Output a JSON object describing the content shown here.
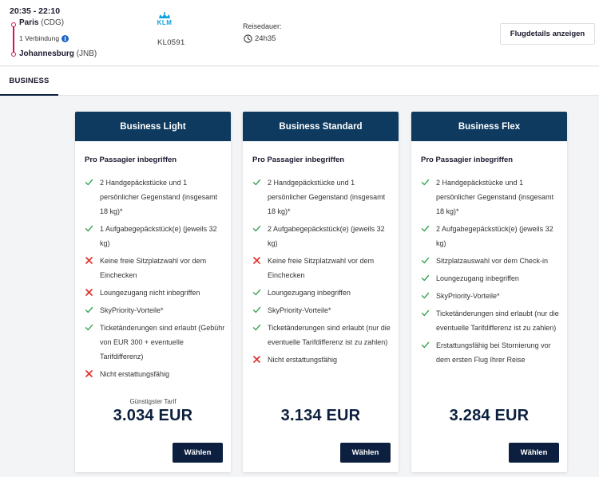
{
  "flight": {
    "times": "20:35 - 22:10",
    "origin_city": "Paris",
    "origin_code": "(CDG)",
    "connections": "1 Verbindung",
    "destination_city": "Johannesburg",
    "destination_code": "(JNB)",
    "airline": "KLM",
    "flight_number": "KL0591",
    "duration_label": "Reisedauer:",
    "duration_value": "24h35",
    "details_button": "Flugdetails anzeigen",
    "route_color": "#d2145a"
  },
  "cabin_tabs": [
    {
      "label": "BUSINESS",
      "active": true
    }
  ],
  "colors": {
    "header_bg": "#0e3a5f",
    "check": "#3aa655",
    "cross": "#e0312d",
    "button_bg": "#0c1f3f"
  },
  "fares": [
    {
      "name": "Business Light",
      "included_title": "Pro Passagier inbegriffen",
      "features": [
        {
          "icon": "check-icon",
          "text": "2 Handgepäckstücke und 1 persönlicher Gegenstand (insgesamt 18 kg)*"
        },
        {
          "icon": "check-icon",
          "text": "1 Aufgabegepäckstück(e) (jeweils 32 kg)"
        },
        {
          "icon": "cross-icon",
          "text": "Keine freie Sitzplatzwahl vor dem Einchecken"
        },
        {
          "icon": "cross-icon",
          "text": "Loungezugang nicht inbegriffen"
        },
        {
          "icon": "check-icon",
          "text": "SkyPriority-Vorteile*"
        },
        {
          "icon": "check-icon",
          "text": "Ticketänderungen sind erlaubt (Gebühr von EUR 300 + eventuelle Tarifdifferenz)"
        },
        {
          "icon": "cross-icon",
          "text": "Nicht erstattungsfähig"
        }
      ],
      "price_note": "Günstigster Tarif",
      "price": "3.034 EUR",
      "button": "Wählen"
    },
    {
      "name": "Business Standard",
      "included_title": "Pro Passagier inbegriffen",
      "features": [
        {
          "icon": "check-icon",
          "text": "2 Handgepäckstücke und 1 persönlicher Gegenstand (insgesamt 18 kg)*"
        },
        {
          "icon": "check-icon",
          "text": "2 Aufgabegepäckstück(e) (jeweils 32 kg)"
        },
        {
          "icon": "cross-icon",
          "text": "Keine freie Sitzplatzwahl vor dem Einchecken"
        },
        {
          "icon": "check-icon",
          "text": "Loungezugang inbegriffen"
        },
        {
          "icon": "check-icon",
          "text": "SkyPriority-Vorteile*"
        },
        {
          "icon": "check-icon",
          "text": "Ticketänderungen sind erlaubt (nur die eventuelle Tarifdifferenz ist zu zahlen)"
        },
        {
          "icon": "cross-icon",
          "text": "Nicht erstattungsfähig"
        }
      ],
      "price_note": "",
      "price": "3.134 EUR",
      "button": "Wählen"
    },
    {
      "name": "Business Flex",
      "included_title": "Pro Passagier inbegriffen",
      "features": [
        {
          "icon": "check-icon",
          "text": "2 Handgepäckstücke und 1 persönlicher Gegenstand (insgesamt 18 kg)*"
        },
        {
          "icon": "check-icon",
          "text": "2 Aufgabegepäckstück(e) (jeweils 32 kg)"
        },
        {
          "icon": "check-icon",
          "text": "Sitzplatzauswahl vor dem Check-in"
        },
        {
          "icon": "check-icon",
          "text": "Loungezugang inbegriffen"
        },
        {
          "icon": "check-icon",
          "text": "SkyPriority-Vorteile*"
        },
        {
          "icon": "check-icon",
          "text": "Ticketänderungen sind erlaubt (nur die eventuelle Tarifdifferenz ist zu zahlen)"
        },
        {
          "icon": "check-icon",
          "text": "Erstattungsfähig bei Stornierung vor dem ersten Flug Ihrer Reise"
        }
      ],
      "price_note": "",
      "price": "3.284 EUR",
      "button": "Wählen"
    }
  ]
}
